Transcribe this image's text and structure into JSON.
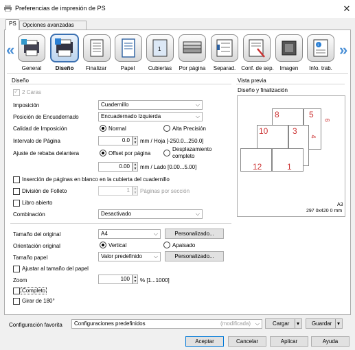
{
  "title": "Preferencias de impresión de PS",
  "tabs": [
    "PS",
    "Opciones avanzadas"
  ],
  "nav": [
    "General",
    "Diseño",
    "Finalizar",
    "Papel",
    "Cubiertas",
    "Por página",
    "Separad.",
    "Conf. de sep.",
    "Imagen",
    "Info. trab."
  ],
  "nav_selected": "Diseño",
  "layout": {
    "group_title": "Diseño",
    "two_sides": "2 Caras",
    "imposition_label": "Imposición",
    "imposition_value": "Cuadernillo",
    "binding_label": "Posición de Encuadernado",
    "binding_value": "Encuadernado Izquierda",
    "quality_label": "Calidad de Imposición",
    "quality_normal": "Normal",
    "quality_high": "Alta Precisión",
    "interval_label": "Intervalo de Página",
    "interval_value": "0.0",
    "interval_unit": "mm / Hoja [-250.0...250.0]",
    "trim_label": "Ajuste de rebaba delantera",
    "trim_offset": "Offset por página",
    "trim_full": "Desplazamiento completo",
    "trim_value": "0.00",
    "trim_unit": "mm / Lado [0.00...5.00]",
    "blank_pages": "Inserción de páginas en blanco en la cubierta del cuadernillo",
    "brochure_division": "División de Folleto",
    "brochure_value": "1",
    "brochure_unit": "Páginas por sección",
    "open_book": "Libro abierto",
    "combination_label": "Combinación",
    "combination_value": "Desactivado",
    "orig_size_label": "Tamaño del original",
    "orig_size_value": "A4",
    "custom_btn": "Personalizado...",
    "orientation_label": "Orientación original",
    "orient_vertical": "Vertical",
    "orient_horizontal": "Apaisado",
    "paper_size_label": "Tamaño papel",
    "paper_size_value": "Valor predefinido",
    "fit_paper": "Ajustar al tamaño del papel",
    "zoom_label": "Zoom",
    "zoom_value": "100",
    "zoom_unit": "% [1...1000]",
    "complete": "Completo",
    "rotate": "Girar de 180°"
  },
  "preview": {
    "title": "Vista previa",
    "subtitle": "Diseño y finalización",
    "size_code": "A3",
    "size_dims": "297 0x420 0 mm",
    "page_numbers": [
      "8",
      "5",
      "6",
      "10",
      "3",
      "4",
      "12",
      "1"
    ]
  },
  "favorites": {
    "label": "Configuración favorita",
    "value": "Configuraciones predefinidos",
    "modified": "(modificada)",
    "load": "Cargar",
    "save": "Guardar"
  },
  "footer": {
    "ok": "Aceptar",
    "cancel": "Cancelar",
    "apply": "Aplicar",
    "help": "Ayuda"
  }
}
